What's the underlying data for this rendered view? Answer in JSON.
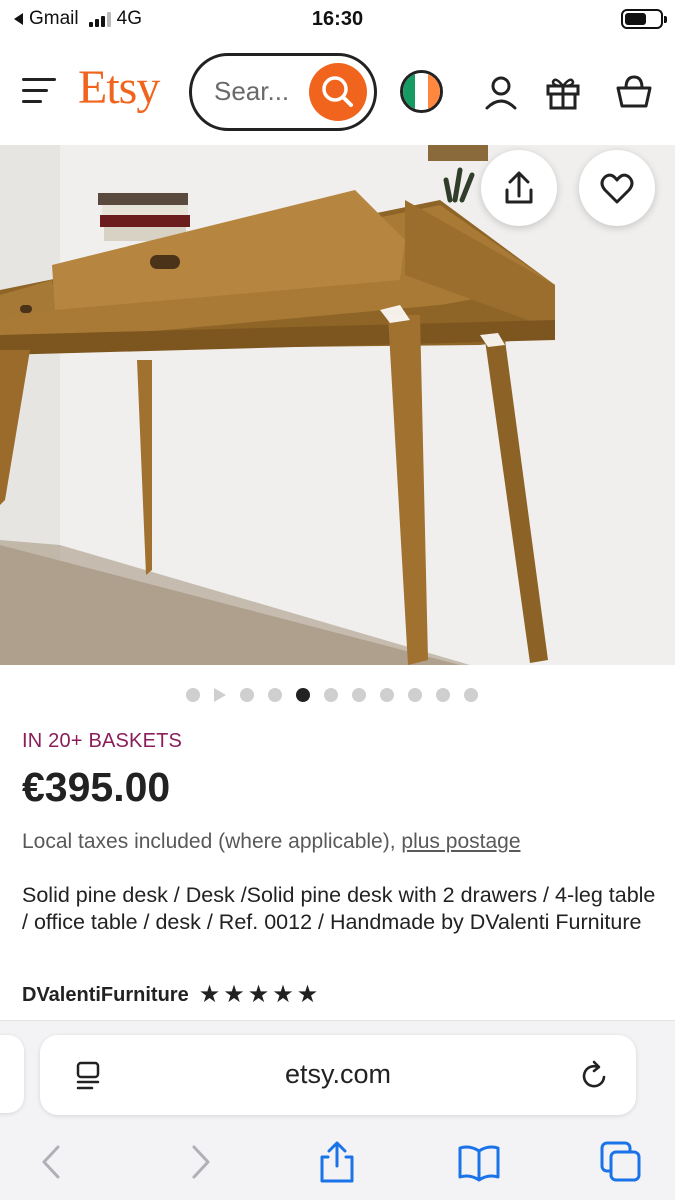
{
  "status_bar": {
    "carrier": "Gmail",
    "network": "4G",
    "time": "16:30"
  },
  "header": {
    "logo": "Etsy",
    "search_placeholder": "Sear...",
    "icons": [
      "menu-icon",
      "search-icon",
      "ireland-flag-icon",
      "account-icon",
      "gift-icon",
      "basket-icon"
    ]
  },
  "hero": {
    "image_subject": "wooden desk photo",
    "actions": [
      "share-icon",
      "heart-icon"
    ],
    "carousel": {
      "total_dots": 11,
      "active_index": 4,
      "has_video": true
    }
  },
  "product": {
    "basket_badge": "IN 20+ BASKETS",
    "price": "€395.00",
    "taxes_text": "Local taxes included (where applicable),",
    "postage_link": "plus postage",
    "title": "Solid pine desk / Desk /Solid pine desk with 2 drawers / 4-leg table / office table / desk / Ref. 0012 / Handmade by DValenti Furniture",
    "shop_name": "DValentiFurniture",
    "rating_stars": 5
  },
  "browser": {
    "url": "etsy.com",
    "icons": [
      "reader-icon",
      "reload-icon",
      "back-icon",
      "forward-icon",
      "share-icon",
      "bookmarks-icon",
      "tabs-icon"
    ]
  },
  "colors": {
    "brand": "#F1641E",
    "basket_badge": "#8B1E5A",
    "safari_accent": "#1A73E8"
  }
}
